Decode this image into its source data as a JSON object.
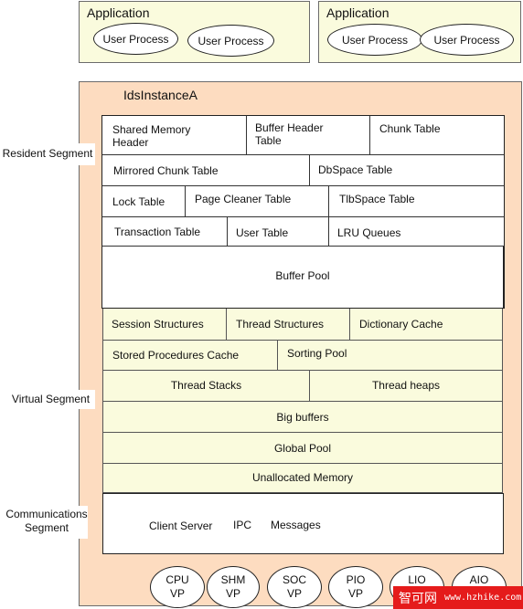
{
  "applications": [
    {
      "title": "Application",
      "processes": [
        "User Process",
        "User Process"
      ]
    },
    {
      "title": "Application",
      "processes": [
        "User Process",
        "User Process"
      ]
    }
  ],
  "instance": {
    "title": "IdsInstanceA",
    "resident_segment": {
      "label": "Resident Segment",
      "rows": [
        [
          "Shared Memory Header",
          "Buffer Header Table",
          "Chunk Table"
        ],
        [
          "Mirrored Chunk Table",
          "DbSpace Table"
        ],
        [
          "Lock Table",
          "Page Cleaner Table",
          "TlbSpace Table"
        ],
        [
          "Transaction Table",
          "User Table",
          "LRU Queues"
        ],
        [
          "Buffer Pool"
        ]
      ]
    },
    "virtual_segment": {
      "label": "Virtual Segment",
      "rows": [
        [
          "Session Structures",
          "Thread Structures",
          "Dictionary Cache"
        ],
        [
          "Stored Procedures Cache",
          "Sorting Pool"
        ],
        [
          "Thread Stacks",
          "Thread heaps"
        ],
        [
          "Big buffers"
        ],
        [
          "Global Pool"
        ],
        [
          "Unallocated Memory"
        ]
      ]
    },
    "communications_segment": {
      "label": "Communications Segment",
      "items": [
        "Client Server",
        "IPC",
        "Messages"
      ]
    },
    "virtual_processors": [
      {
        "name": "CPU",
        "suffix": "VP"
      },
      {
        "name": "SHM",
        "suffix": "VP"
      },
      {
        "name": "SOC",
        "suffix": "VP"
      },
      {
        "name": "PIO",
        "suffix": "VP"
      },
      {
        "name": "LIO",
        "suffix": "VP"
      },
      {
        "name": "AIO",
        "suffix": "VP"
      }
    ]
  },
  "watermark": {
    "cn": "智可网",
    "url": "www.hzhike.com"
  }
}
